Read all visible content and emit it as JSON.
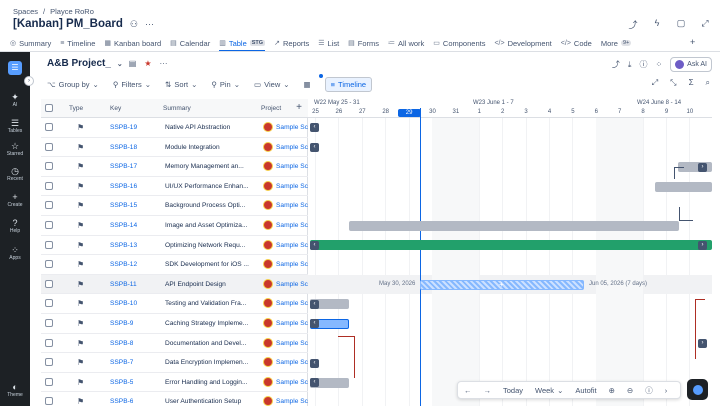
{
  "breadcrumb": [
    "Spaces",
    "/",
    "Playce RoRo"
  ],
  "page_title": "[Kanban] PM_Board",
  "tabs": [
    {
      "label": "Summary",
      "icon": "◎"
    },
    {
      "label": "Timeline",
      "icon": "≡"
    },
    {
      "label": "Kanban board",
      "icon": "▦"
    },
    {
      "label": "Calendar",
      "icon": "▤"
    },
    {
      "label": "Table",
      "icon": "▥",
      "badge": "STG",
      "active": true
    },
    {
      "label": "Reports",
      "icon": "↗"
    },
    {
      "label": "List",
      "icon": "☰"
    },
    {
      "label": "Forms",
      "icon": "▤"
    },
    {
      "label": "All work",
      "icon": "≔"
    },
    {
      "label": "Components",
      "icon": "▭"
    },
    {
      "label": "Development",
      "icon": "</>"
    },
    {
      "label": "Code",
      "icon": "</>"
    },
    {
      "label": "More",
      "icon": "",
      "badge": "9+"
    }
  ],
  "sidebar": [
    {
      "label": "AI",
      "icon": "✦"
    },
    {
      "label": "Tables",
      "icon": "☰"
    },
    {
      "label": "Starred",
      "icon": "☆"
    },
    {
      "label": "Recent",
      "icon": "◷"
    },
    {
      "label": "Create",
      "icon": "+"
    },
    {
      "label": "Help",
      "icon": "?"
    },
    {
      "label": "Apps",
      "icon": "⁘"
    },
    {
      "label": "Theme",
      "icon": "◐"
    }
  ],
  "board": {
    "title": "A&B Project_",
    "ask_ai": "Ask AI"
  },
  "toolbar": {
    "group_by": "Group by",
    "filters": "Filters",
    "sort": "Sort",
    "pin": "Pin",
    "view": "View",
    "timeline": "Timeline"
  },
  "table": {
    "headers": {
      "type": "Type",
      "key": "Key",
      "summary": "Summary",
      "project": "Project"
    },
    "rows": [
      {
        "key": "SSPB-19",
        "summary": "Native API Abstraction",
        "project": "Sample Sc"
      },
      {
        "key": "SSPB-18",
        "summary": "Module Integration",
        "project": "Sample Sc"
      },
      {
        "key": "SSPB-17",
        "summary": "Memory Management an...",
        "project": "Sample Sc"
      },
      {
        "key": "SSPB-16",
        "summary": "UI/UX Performance Enhan...",
        "project": "Sample Sc"
      },
      {
        "key": "SSPB-15",
        "summary": "Background Process Opti...",
        "project": "Sample Sc"
      },
      {
        "key": "SSPB-14",
        "summary": "Image and Asset Optimiza...",
        "project": "Sample Sc"
      },
      {
        "key": "SSPB-13",
        "summary": "Optimizing Network Requ...",
        "project": "Sample Sc"
      },
      {
        "key": "SSPB-12",
        "summary": "SDK Development for iOS ...",
        "project": "Sample Sc"
      },
      {
        "key": "SSPB-11",
        "summary": "API Endpoint Design",
        "project": "Sample Sc"
      },
      {
        "key": "SSPB-10",
        "summary": "Testing and Validation Fra...",
        "project": "Sample Sc"
      },
      {
        "key": "SSPB-9",
        "summary": "Caching Strategy Impleme...",
        "project": "Sample Sc"
      },
      {
        "key": "SSPB-8",
        "summary": "Documentation and Devel...",
        "project": "Sample Sc"
      },
      {
        "key": "SSPB-7",
        "summary": "Data Encryption Implemen...",
        "project": "Sample Sc"
      },
      {
        "key": "SSPB-5",
        "summary": "Error Handling and Loggin...",
        "project": "Sample Sc"
      },
      {
        "key": "SSPB-6",
        "summary": "User Authentication Setup",
        "project": "Sample Sc"
      }
    ]
  },
  "timeline": {
    "weeks": [
      "W22 May 25 - 31",
      "W23 June 1 - 7",
      "W24 June 8 - 14"
    ],
    "days": [
      "25",
      "26",
      "27",
      "28",
      "29",
      "30",
      "31",
      "1",
      "2",
      "3",
      "4",
      "5",
      "6",
      "7",
      "8",
      "9",
      "10"
    ],
    "today": "29",
    "start_label": "May 30, 2026",
    "end_label": "Jun 05, 2026 (7 days)"
  },
  "zoom": {
    "today": "Today",
    "week": "Week",
    "autofit": "Autofit"
  },
  "colors": {
    "accent": "#0c66e4",
    "green_bar": "#22a06b",
    "grey_bar": "#b3b9c4",
    "sidebar": "#1d2125"
  }
}
